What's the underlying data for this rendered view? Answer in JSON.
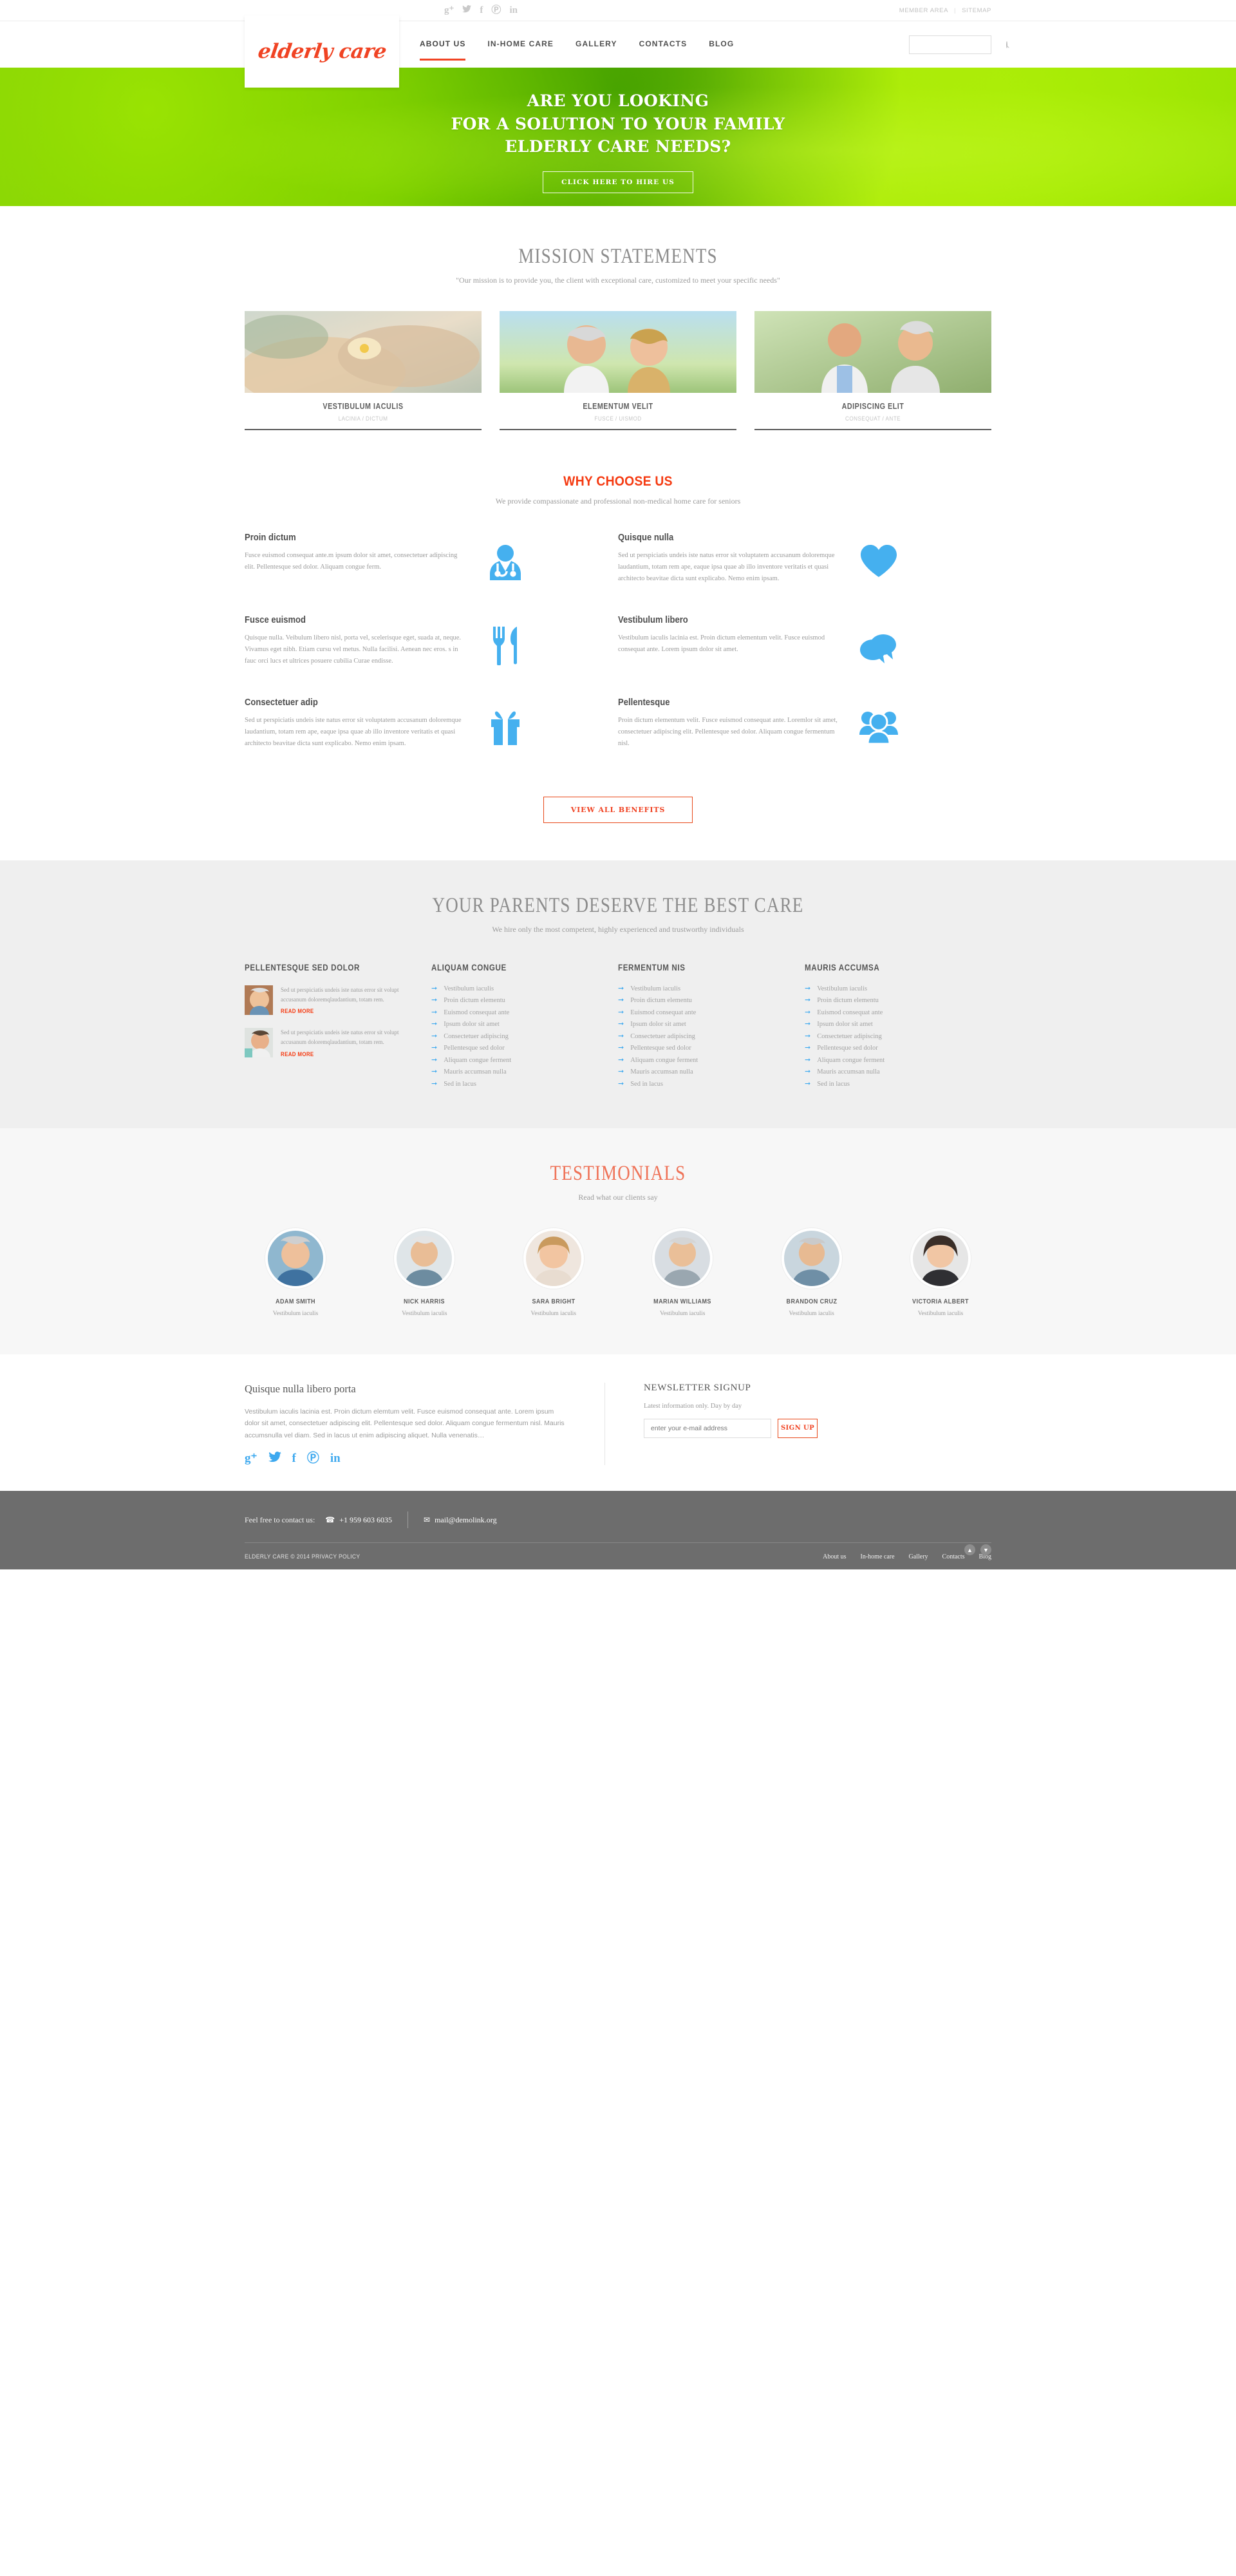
{
  "topbar": {
    "social": [
      {
        "name": "googleplus-icon",
        "glyph": "g⁺"
      },
      {
        "name": "twitter-icon",
        "glyph": "ᵗ"
      },
      {
        "name": "facebook-icon",
        "glyph": "f"
      },
      {
        "name": "pinterest-icon",
        "glyph": "Ⓟ"
      },
      {
        "name": "linkedin-icon",
        "glyph": "in"
      }
    ],
    "member_area": "MEMBER AREA",
    "separator": "|",
    "sitemap": "SITEMAP"
  },
  "header": {
    "logo": "elderly care",
    "nav": [
      {
        "label": "ABOUT US",
        "active": true
      },
      {
        "label": "IN-HOME CARE",
        "active": false
      },
      {
        "label": "GALLERY",
        "active": false
      },
      {
        "label": "CONTACTS",
        "active": false
      },
      {
        "label": "BLOG",
        "active": false
      }
    ],
    "search_placeholder": ""
  },
  "hero": {
    "line1": "ARE YOU LOOKING",
    "line2": "FOR A SOLUTION TO YOUR FAMILY",
    "line3": "ELDERLY CARE NEEDS?",
    "button": "CLICK HERE TO HIRE US"
  },
  "mission": {
    "title": "MISSION STATEMENTS",
    "subtitle": "\"Our mission is to provide you, the client with exceptional care, customized to meet your specific needs\"",
    "cards": [
      {
        "title": "VESTIBULUM IACULIS",
        "meta": "LACINIA / DICTUM"
      },
      {
        "title": "ELEMENTUM VELIT",
        "meta": "FUSCE / UISMOD"
      },
      {
        "title": "ADIPISCING ELIT",
        "meta": "CONSEQUAT / ANTE"
      }
    ]
  },
  "why": {
    "title": "WHY CHOOSE US",
    "subtitle": "We provide compassionate and professional non-medical home care for seniors",
    "button": "VIEW ALL BENEFITS",
    "items": [
      {
        "title": "Proin dictum",
        "text": "Fusce euismod consequat ante.m ipsum dolor sit amet, consectetuer adipiscing elit. Pellentesque sed dolor. Aliquam congue ferm.",
        "icon": "doctor-icon"
      },
      {
        "title": "Quisque nulla",
        "text": "Sed ut perspiciatis undeis iste natus error sit voluptatem accusanum doloremque laudantium, totam rem ape, eaque ipsa quae ab illo inventore veritatis et quasi architecto beavitae dicta sunt explicabo. Nemo enim ipsam.",
        "icon": "heart-icon"
      },
      {
        "title": "Fusce euismod",
        "text": "Quisque nulla. Veibulum libero nisl, porta vel, scelerisque eget, suada at, neque. Vivamus eget nibh. Etiam cursu vel metus. Nulla facilisi. Aenean nec eros. s in fauc orci lucs et ultrices posuere cubilia Curae endisse.",
        "icon": "cutlery-icon"
      },
      {
        "title": "Vestibulum libero",
        "text": "Vestibulum iaculis lacinia est. Proin dictum elementum velit. Fusce euismod consequat ante. Lorem ipsum dolor sit amet.",
        "icon": "chat-bubbles-icon"
      },
      {
        "title": "Consectetuer adip",
        "text": "Sed ut perspiciatis undeis iste natus error sit voluptatem accusanum doloremque laudantium, totam rem ape, eaque ipsa quae ab illo inventore veritatis et quasi architecto beavitae dicta sunt explicabo. Nemo enim ipsam.",
        "icon": "gift-icon"
      },
      {
        "title": "Pellentesque",
        "text": "Proin dictum elementum velit. Fusce euismod consequat ante. Loremlor sit amet, consectetuer adipiscing elit. Pellentesque sed dolor. Aliquam congue fermentum nisl.",
        "icon": "people-icon"
      }
    ]
  },
  "parents": {
    "title": "YOUR PARENTS DESERVE THE BEST CARE",
    "subtitle": "We hire only the most competent, highly experienced and trustworthy individuals",
    "posts_title": "PELLENTESQUE SED DOLOR",
    "posts": [
      {
        "text": "Sed ut perspiciatis undeis iste natus error sit volupt accusanum doloremqlaudantium, totam rem.",
        "link": "READ MORE"
      },
      {
        "text": "Sed ut perspiciatis undeis iste natus error sit volupt accusanum doloremqlaudantium, totam rem.",
        "link": "READ MORE"
      }
    ],
    "lists": [
      {
        "title": "ALIQUAM CONGUE",
        "items": [
          "Vestibulum iaculis",
          "Proin dictum elementu",
          "Euismod consequat ante",
          "Ipsum dolor sit amet",
          "Consectetuer adipiscing",
          "Pellentesque sed dolor",
          "Aliquam congue ferment",
          "Mauris accumsan nulla",
          "Sed in lacus"
        ]
      },
      {
        "title": "FERMENTUM NIS",
        "items": [
          "Vestibulum iaculis",
          "Proin dictum elementu",
          "Euismod consequat ante",
          "Ipsum dolor sit amet",
          "Consectetuer adipiscing",
          "Pellentesque sed dolor",
          "Aliquam congue ferment",
          "Mauris accumsan nulla",
          "Sed in lacus"
        ]
      },
      {
        "title": "MAURIS ACCUMSA",
        "items": [
          "Vestibulum iaculis",
          "Proin dictum elementu",
          "Euismod consequat ante",
          "Ipsum dolor sit amet",
          "Consectetuer adipiscing",
          "Pellentesque sed dolor",
          "Aliquam congue ferment",
          "Mauris accumsan nulla",
          "Sed in lacus"
        ]
      }
    ]
  },
  "testimonials": {
    "title": "TESTIMONIALS",
    "subtitle": "Read what our clients say",
    "people": [
      {
        "name": "ADAM SMITH",
        "role": "Vestibulum iaculis"
      },
      {
        "name": "NICK HARRIS",
        "role": "Vestibulum iaculis"
      },
      {
        "name": "SARA BRIGHT",
        "role": "Vestibulum iaculis"
      },
      {
        "name": "MARIAN WILLIAMS",
        "role": "Vestibulum iaculis"
      },
      {
        "name": "BRANDON CRUZ",
        "role": "Vestibulum iaculis"
      },
      {
        "name": "VICTORIA ALBERT",
        "role": "Vestibulum iaculis"
      }
    ]
  },
  "footer_widgets": {
    "about_title": "Quisque nulla libero porta",
    "about_text": "Vestibulum iaculis lacinia est. Proin dictum elemtum velit. Fusce euismod consequat ante. Lorem ipsum dolor sit amet, consectetuer adipiscing elit. Pellentesque sed dolor. Aliquam congue fermentum nisl. Mauris accumsnulla vel diam. Sed in lacus ut enim adipiscing aliquet. Nulla venenatis…",
    "social": [
      {
        "name": "googleplus-icon",
        "glyph": "g⁺"
      },
      {
        "name": "twitter-icon",
        "glyph": "ᵗ"
      },
      {
        "name": "facebook-icon",
        "glyph": "f"
      },
      {
        "name": "pinterest-icon",
        "glyph": "Ⓟ"
      },
      {
        "name": "linkedin-icon",
        "glyph": "in"
      }
    ],
    "newsletter_title": "NEWSLETTER SIGNUP",
    "newsletter_text": "Latest information only. Day by day",
    "newsletter_placeholder": "enter your e-mail address",
    "newsletter_button": "SIGN UP"
  },
  "footer": {
    "contact_label": "Feel free to contact us:",
    "phone": "+1 959 603 6035",
    "email": "mail@demolink.org",
    "copyright": "ELDERLY CARE © 2014 Privacy policy",
    "nav": [
      "About us",
      "In-home care",
      "Gallery",
      "Contacts",
      "Blog"
    ]
  },
  "colors": {
    "accent_red": "#f04323",
    "accent_blue": "#45b0ef",
    "footer_gray": "#6d6d6d",
    "section_gray": "#efefef"
  }
}
